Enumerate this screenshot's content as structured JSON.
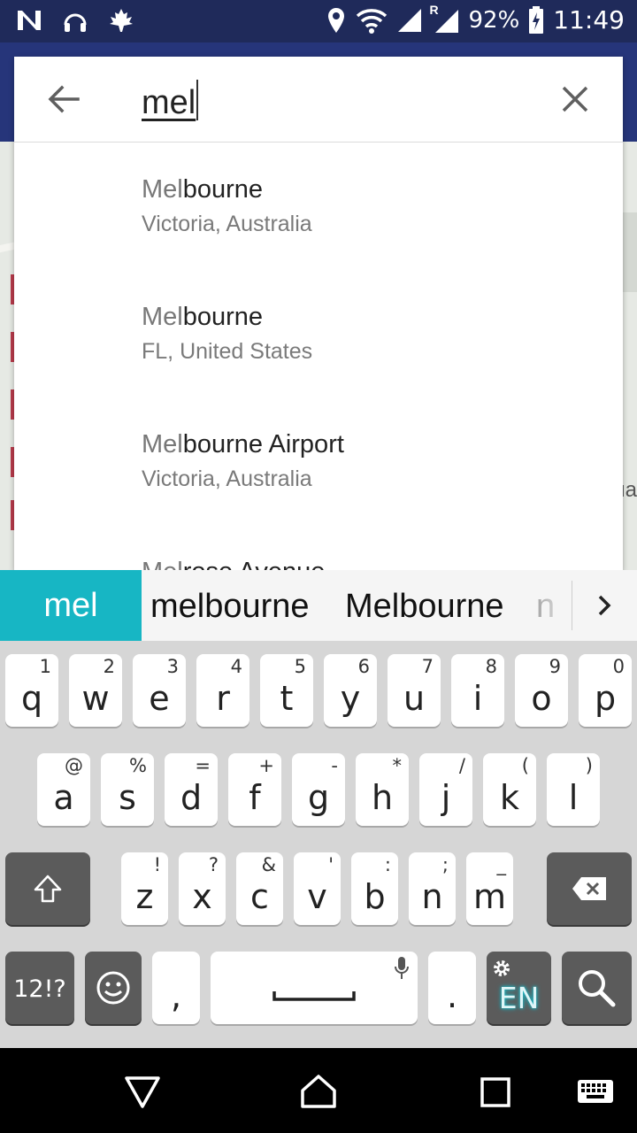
{
  "status_bar": {
    "battery": "92%",
    "time": "11:49",
    "roaming": "R",
    "left_icons": [
      "n-icon",
      "headphones-icon",
      "maple-leaf-icon"
    ],
    "right_icons": [
      "location-icon",
      "wifi-icon",
      "signal-icon",
      "signal-roaming-icon",
      "battery-charging-icon"
    ]
  },
  "search": {
    "query": "mel",
    "back_icon": "arrow-left-icon",
    "clear_icon": "close-icon"
  },
  "results": [
    {
      "match": "Mel",
      "rest": "bourne",
      "subtitle": "Victoria, Australia"
    },
    {
      "match": "Mel",
      "rest": "bourne",
      "subtitle": "FL, United States"
    },
    {
      "match": "Mel",
      "rest": "bourne Airport",
      "subtitle": "Victoria, Australia"
    },
    {
      "match": "Mel",
      "rest": "rose Avenue",
      "subtitle": ""
    }
  ],
  "map": {
    "partial_label": "ua"
  },
  "suggestions": {
    "active": "mel",
    "items": [
      "melbourne",
      "Melbourne",
      "n"
    ],
    "more_icon": "chevron-right-icon"
  },
  "keyboard": {
    "row1": [
      {
        "key": "q",
        "hint": "1"
      },
      {
        "key": "w",
        "hint": "2"
      },
      {
        "key": "e",
        "hint": "3"
      },
      {
        "key": "r",
        "hint": "4"
      },
      {
        "key": "t",
        "hint": "5"
      },
      {
        "key": "y",
        "hint": "6"
      },
      {
        "key": "u",
        "hint": "7"
      },
      {
        "key": "i",
        "hint": "8"
      },
      {
        "key": "o",
        "hint": "9"
      },
      {
        "key": "p",
        "hint": "0"
      }
    ],
    "row2": [
      {
        "key": "a",
        "hint": "@"
      },
      {
        "key": "s",
        "hint": "%"
      },
      {
        "key": "d",
        "hint": "="
      },
      {
        "key": "f",
        "hint": "+"
      },
      {
        "key": "g",
        "hint": "-"
      },
      {
        "key": "h",
        "hint": "*"
      },
      {
        "key": "j",
        "hint": "/"
      },
      {
        "key": "k",
        "hint": "("
      },
      {
        "key": "l",
        "hint": ")"
      }
    ],
    "row3": [
      {
        "key": "z",
        "hint": "!"
      },
      {
        "key": "x",
        "hint": "?"
      },
      {
        "key": "c",
        "hint": "&"
      },
      {
        "key": "v",
        "hint": "'"
      },
      {
        "key": "b",
        "hint": ":"
      },
      {
        "key": "n",
        "hint": ";"
      },
      {
        "key": "m",
        "hint": "_"
      }
    ],
    "symbols_label": "12!?",
    "comma": ",",
    "period": ".",
    "language": "EN",
    "accent_color": "#17b6c4"
  },
  "colors": {
    "status_bar": "#1f2a5a",
    "app_bar": "#26357a",
    "suggestion_active": "#17b6c4"
  }
}
